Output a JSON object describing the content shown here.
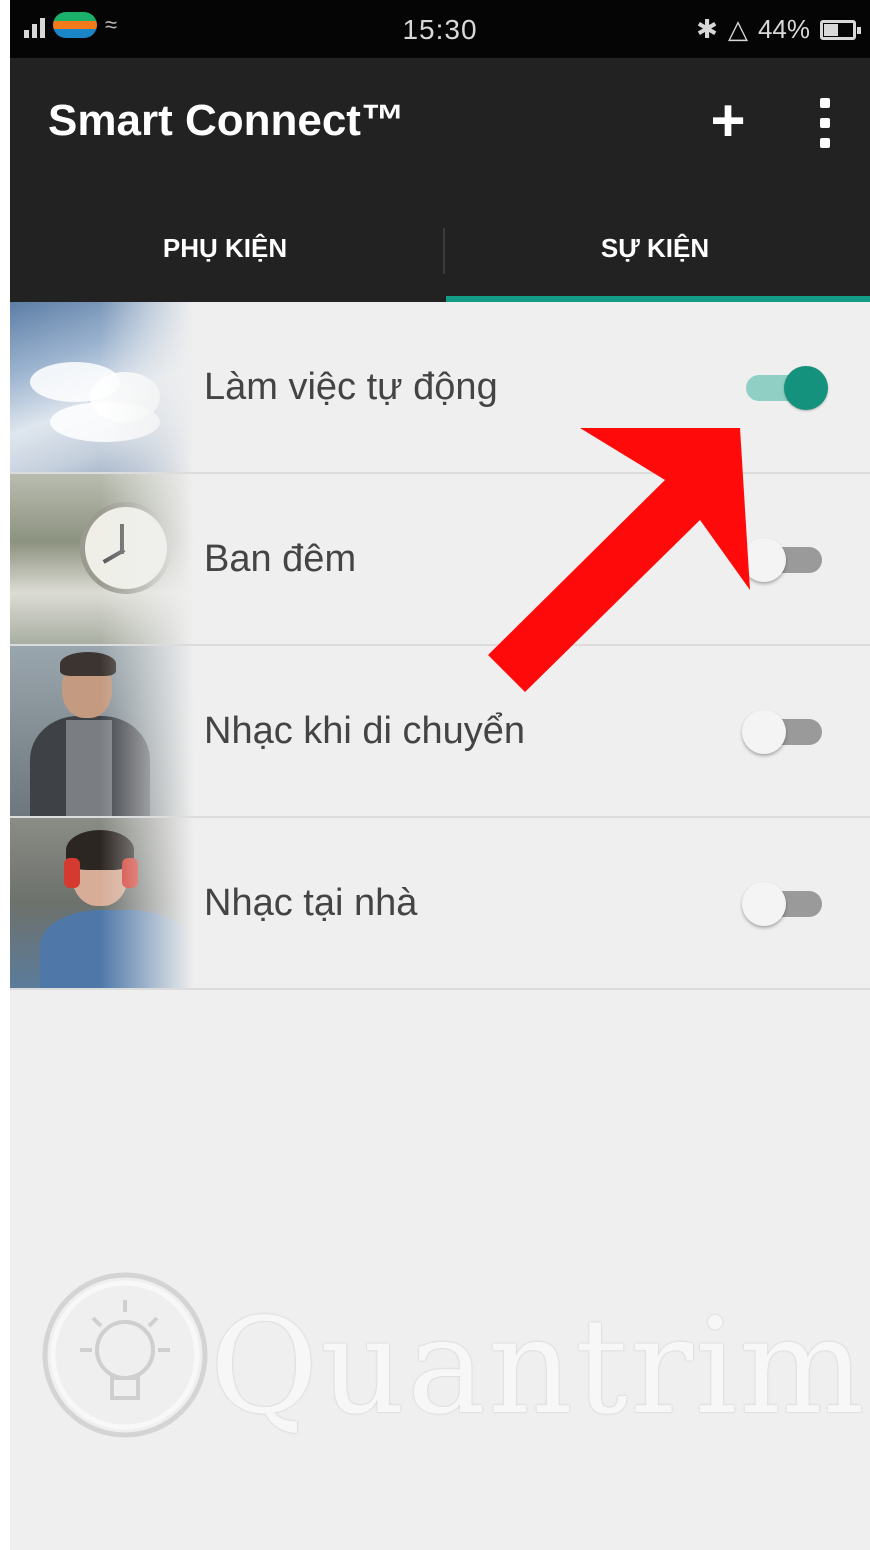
{
  "status_bar": {
    "time": "15:30",
    "battery": "44%",
    "icons": [
      "signal-icon",
      "carrier-logo",
      "wifi-icon",
      "bluetooth-icon",
      "alarm-icon",
      "battery-icon"
    ]
  },
  "app_bar": {
    "title": "Smart Connect™",
    "add_label": "+",
    "icons": [
      "add-icon",
      "more-vert-icon"
    ]
  },
  "tabs": [
    {
      "label": "PHỤ KIỆN",
      "selected": false
    },
    {
      "label": "SỰ KIỆN",
      "selected": true
    }
  ],
  "events": [
    {
      "label": "Làm việc tự động",
      "enabled": true,
      "thumbnail": "sky-clouds"
    },
    {
      "label": "Ban đêm",
      "enabled": false,
      "thumbnail": "alarm-clock"
    },
    {
      "label": "Nhạc khi di chuyển",
      "enabled": false,
      "thumbnail": "man-walking"
    },
    {
      "label": "Nhạc tại nhà",
      "enabled": false,
      "thumbnail": "girl-headphones"
    }
  ],
  "annotation": {
    "color": "#ff0a0a",
    "target": "toggle-lam-viec-tu-dong"
  },
  "watermark": {
    "text": "Quantrimang"
  },
  "colors": {
    "accent": "#149b86",
    "app_bar": "#222222",
    "background": "#efefef",
    "arrow": "#ff0a0a"
  }
}
